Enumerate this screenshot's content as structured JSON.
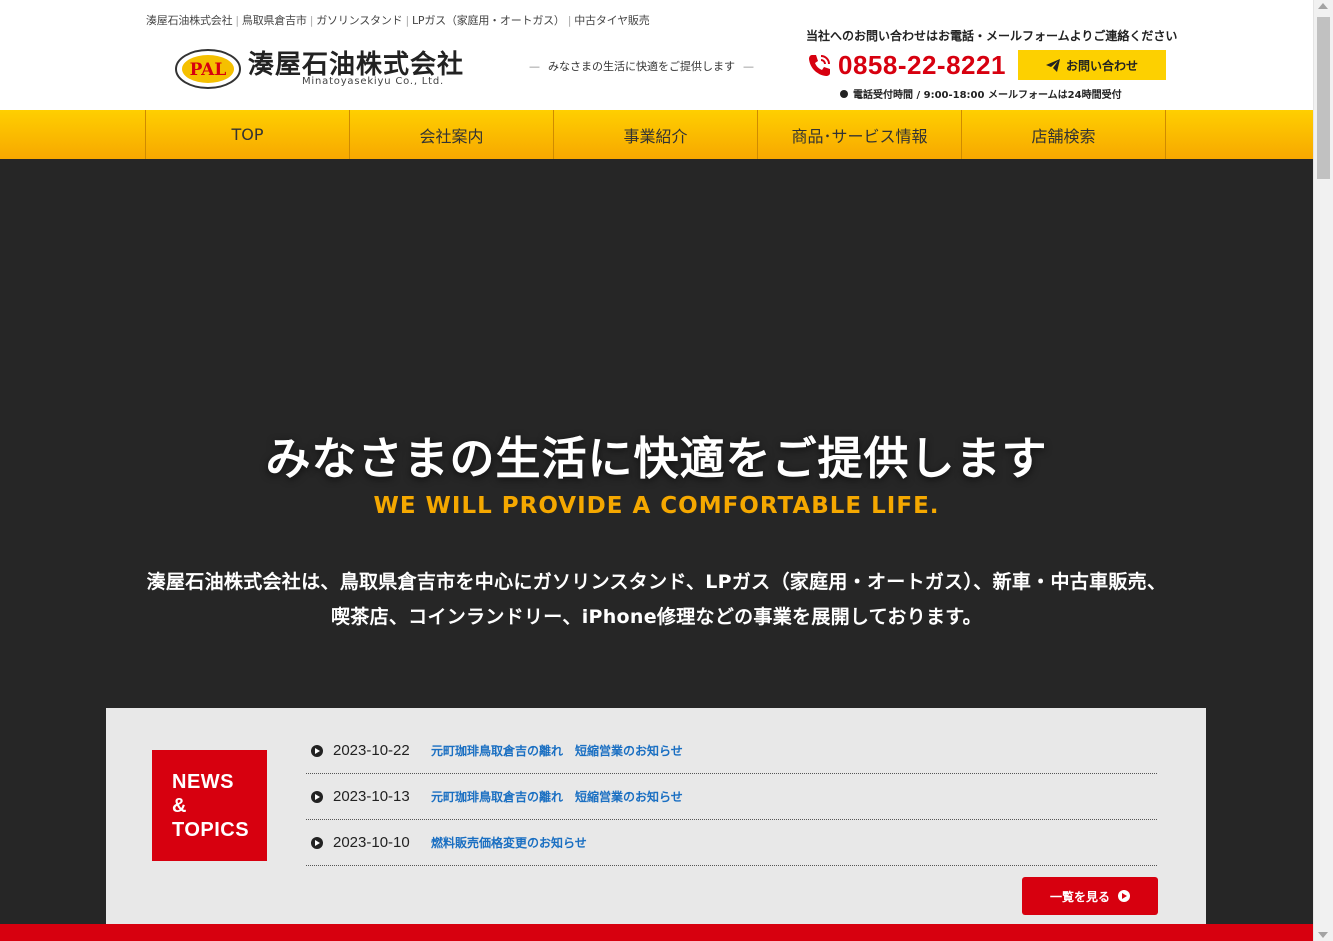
{
  "header": {
    "breadcrumb": [
      "湊屋石油株式会社",
      "鳥取県倉吉市",
      "ガソリンスタンド",
      "LPガス（家庭用・オートガス）",
      "中古タイヤ販売"
    ],
    "logo_mark_text": "PAL",
    "company_name": "湊屋石油株式会社",
    "company_name_en": "Minatoyasekiyu Co., Ltd.",
    "tagline": "みなさまの生活に快適をご提供します",
    "contact_note": "当社へのお問い合わせはお電話・メールフォームよりご連絡ください",
    "phone": "0858-22-8221",
    "contact_button": "お問い合わせ",
    "hours": "電話受付時間 / 9:00-18:00 メールフォームは24時間受付"
  },
  "nav": {
    "items": [
      "TOP",
      "会社案内",
      "事業紹介",
      "商品･サービス情報",
      "店舗検索"
    ]
  },
  "hero": {
    "title": "みなさまの生活に快適をご提供します",
    "subtitle": "WE WILL PROVIDE A COMFORTABLE LIFE.",
    "desc_line1": "湊屋石油株式会社は、鳥取県倉吉市を中心にガソリンスタンド、LPガス（家庭用・オートガス）、新車・中古車販売、",
    "desc_line2": "喫茶店、コインランドリー、iPhone修理などの事業を展開しております。"
  },
  "news": {
    "label_line1": "NEWS",
    "label_line2": "&",
    "label_line3": "TOPICS",
    "items": [
      {
        "date": "2023-10-22",
        "title": "元町珈琲鳥取倉吉の離れ　短縮営業のお知らせ"
      },
      {
        "date": "2023-10-13",
        "title": "元町珈琲鳥取倉吉の離れ　短縮営業のお知らせ"
      },
      {
        "date": "2023-10-10",
        "title": "燃料販売価格変更のお知らせ"
      }
    ],
    "more_button": "一覧を見る"
  },
  "colors": {
    "brand_red": "#d7000f",
    "nav_yellow": "#ffcf00",
    "accent_orange": "#f5a800",
    "hero_bg": "#262626"
  }
}
